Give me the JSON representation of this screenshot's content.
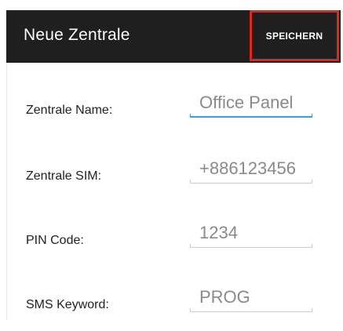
{
  "appbar": {
    "title": "Neue Zentrale",
    "save_label": "SPEICHERN",
    "bg_color": "#1f1f1f",
    "highlight_color": "#e0251f"
  },
  "form": {
    "fields": [
      {
        "label": "Zentrale Name:",
        "value": "Office Panel",
        "focused": true
      },
      {
        "label": "Zentrale SIM:",
        "value": "+886123456",
        "focused": false
      },
      {
        "label": "PIN Code:",
        "value": "1234",
        "focused": false
      },
      {
        "label": "SMS Keyword:",
        "value": "PROG",
        "focused": false
      }
    ],
    "focus_color": "#3aa0d8"
  }
}
